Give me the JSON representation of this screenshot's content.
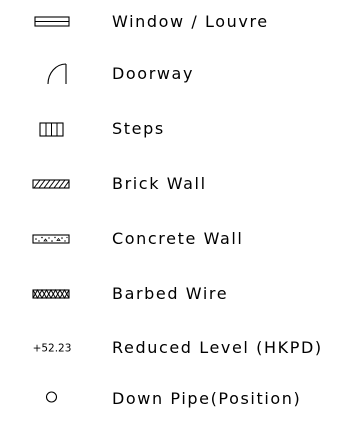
{
  "legend": {
    "items": [
      {
        "symbol": "window-louvre-icon",
        "label": "Window / Louvre"
      },
      {
        "symbol": "doorway-icon",
        "label": "Doorway"
      },
      {
        "symbol": "steps-icon",
        "label": "Steps"
      },
      {
        "symbol": "brick-wall-icon",
        "label": "Brick Wall"
      },
      {
        "symbol": "concrete-wall-icon",
        "label": "Concrete Wall"
      },
      {
        "symbol": "barbed-wire-icon",
        "label": "Barbed Wire"
      },
      {
        "symbol": "reduced-level-marker",
        "symbol_text": "+52.23",
        "label": "Reduced Level (HKPD)"
      },
      {
        "symbol": "down-pipe-icon",
        "label": "Down Pipe(Position)"
      }
    ]
  }
}
